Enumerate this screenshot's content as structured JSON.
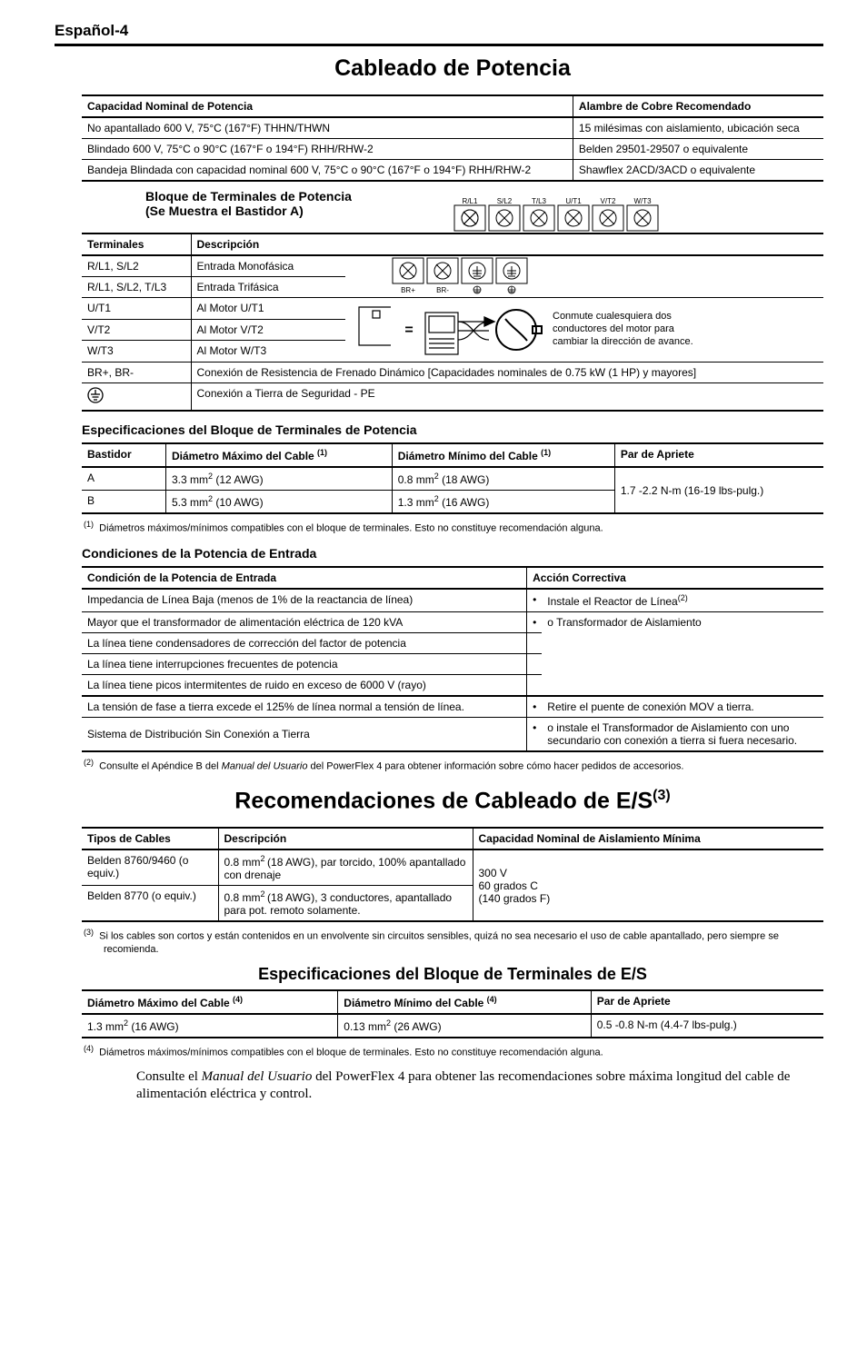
{
  "page_header": "Español-4",
  "section1": {
    "title": "Cableado de Potencia",
    "table1": {
      "h1": "Capacidad Nominal de Potencia",
      "h2": "Alambre de Cobre Recomendado",
      "r1c1": "No apantallado 600 V, 75°C (167°F) THHN/THWN",
      "r1c2": "15 milésimas con aislamiento, ubicación seca",
      "r2c1": "Blindado 600 V, 75°C o 90°C (167°F o 194°F) RHH/RHW-2",
      "r2c2": "Belden 29501-29507 o equivalente",
      "r3c1": "Bandeja Blindada con capacidad nominal 600 V, 75°C o 90°C (167°F o 194°F) RHH/RHW-2",
      "r3c2": "Shawflex 2ACD/3ACD o equivalente"
    },
    "terminal_block": {
      "title_l1": "Bloque de Terminales de Potencia",
      "title_l2": "(Se Muestra el Bastidor A)",
      "h1": "Terminales",
      "h2": "Descripción",
      "r1c1": "R/L1, S/L2",
      "r1c2": "Entrada Monofásica",
      "r2c1": "R/L1, S/L2, T/L3",
      "r2c2": "Entrada Trifásica",
      "r3c1": "U/T1",
      "r3c2": "Al Motor U/T1",
      "r4c1": "V/T2",
      "r4c2": "Al Motor V/T2",
      "r5c1": "W/T3",
      "r5c2": "Al Motor W/T3",
      "r6c1": "BR+, BR-",
      "r6c2": "Conexión de Resistencia de Frenado Dinámico [Capacidades nominales de 0.75 kW (1 HP) y mayores]",
      "r7c1": "",
      "r7c2": "Conexión a Tierra de Seguridad - PE",
      "labels": {
        "t1": "R/L1",
        "t2": "S/L2",
        "t3": "T/L3",
        "t4": "U/T1",
        "t5": "V/T2",
        "t6": "W/T3",
        "b1": "BR+",
        "b2": "BR-"
      },
      "motor_note_l1": "Conmute cualesquiera dos",
      "motor_note_l2": "conductores del motor para",
      "motor_note_l3": "cambiar la dirección de avance.",
      "eq": "="
    },
    "spec_title": "Especificaciones del Bloque de Terminales de Potencia",
    "spec_table": {
      "h1": "Bastidor",
      "h2a": "Diámetro Máximo del Cable ",
      "h2s": "(1)",
      "h3a": "Diámetro Mínimo del Cable ",
      "h3s": "(1)",
      "h4": "Par de Apriete",
      "r1c1": "A",
      "r1c2a": "3.3 mm",
      "r1c2s": "2",
      "r1c2b": " (12 AWG)",
      "r1c3a": "0.8 mm",
      "r1c3s": "2",
      "r1c3b": " (18 AWG)",
      "r2c1": "B",
      "r2c2a": "5.3 mm",
      "r2c2s": "2",
      "r2c2b": " (10 AWG)",
      "r2c3a": "1.3 mm",
      "r2c3s": "2",
      "r2c3b": " (16 AWG)",
      "rmc4": "1.7 -2.2 N-m (16-19 lbs-pulg.)"
    },
    "foot1_sup": "(1)",
    "foot1": "Diámetros máximos/mínimos compatibles con el bloque de terminales. Esto no constituye recomendación alguna.",
    "cond_title": "Condiciones de la Potencia de Entrada",
    "cond_table": {
      "h1": "Condición de la Potencia de Entrada",
      "h2": "Acción Correctiva",
      "r1": "Impedancia de Línea Baja (menos de 1% de la reactancia de línea)",
      "a1a": "Instale el Reactor de Línea",
      "a1s": "(2)",
      "a1b": "o Transformador de Aislamiento",
      "r2": "Mayor que el transformador de alimentación eléctrica de 120 kVA",
      "r3": "La línea tiene condensadores de corrección del factor de potencia",
      "r4": "La línea tiene interrupciones frecuentes de potencia",
      "r5": "La línea tiene picos intermitentes de ruido en exceso de 6000 V (rayo)",
      "r6": "La tensión de fase a tierra excede el 125% de línea normal a tensión de línea.",
      "r7": "Sistema de Distribución Sin Conexión a Tierra",
      "a2a": "Retire el puente de conexión MOV a tierra.",
      "a2b": "o instale el Transformador de Aislamiento con uno secundario con conexión a tierra si fuera necesario."
    },
    "foot2_sup": "(2)",
    "foot2a": "Consulte el Apéndice B del ",
    "foot2i": "Manual del Usuario",
    "foot2b": " del PowerFlex 4 para obtener información sobre cómo hacer pedidos de accesorios."
  },
  "section2": {
    "title_a": "Recomendaciones de Cableado de E/S",
    "title_s": "(3)",
    "table": {
      "h1": "Tipos de Cables",
      "h2": "Descripción",
      "h3": "Capacidad Nominal de Aislamiento Mínima",
      "r1c1": "Belden 8760/9460 (o equiv.)",
      "r1c2a": "0.8 mm",
      "r1c2s": "2 ",
      "r1c2b": "(18 AWG), par torcido, 100% apantallado con drenaje",
      "r2c1": "Belden 8770 (o equiv.)",
      "r2c2a": "0.8 mm",
      "r2c2s": "2 ",
      "r2c2b": "(18 AWG), 3 conductores, apantallado para pot. remoto solamente.",
      "rmc3_l1": "300 V",
      "rmc3_l2": "60 grados C",
      "rmc3_l3": "(140 grados F)"
    },
    "foot3_sup": "(3)",
    "foot3": "Si los cables son cortos y están contenidos en un envolvente sin circuitos sensibles, quizá no sea necesario el uso de cable apantallado, pero siempre se recomienda.",
    "spec_title": "Especificaciones del Bloque de Terminales de E/S",
    "spec_table": {
      "h1a": "Diámetro Máximo del Cable ",
      "h1s": "(4)",
      "h2a": "Diámetro Mínimo del Cable ",
      "h2s": "(4)",
      "h3": "Par de Apriete",
      "r1c1a": "1.3 mm",
      "r1c1s": "2",
      "r1c1b": " (16 AWG)",
      "r1c2a": "0.13 mm",
      "r1c2s": "2",
      "r1c2b": " (26 AWG)",
      "r1c3": "0.5 -0.8 N-m (4.4-7 lbs-pulg.)"
    },
    "foot4_sup": "(4)",
    "foot4": "Diámetros máximos/mínimos compatibles con el bloque de terminales. Esto no constituye recomendación alguna.",
    "closing_a": "Consulte el ",
    "closing_i": "Manual del Usuario",
    "closing_b": " del PowerFlex 4 para obtener las recomendaciones sobre máxima longitud del cable de alimentación eléctrica y control."
  },
  "chart_data": {
    "type": "table",
    "tables": [
      {
        "title": "Capacidad Nominal de Potencia / Alambre de Cobre Recomendado",
        "columns": [
          "Capacidad Nominal de Potencia",
          "Alambre de Cobre Recomendado"
        ],
        "rows": [
          [
            "No apantallado 600 V, 75°C (167°F) THHN/THWN",
            "15 milésimas con aislamiento, ubicación seca"
          ],
          [
            "Blindado 600 V, 75°C o 90°C (167°F o 194°F) RHH/RHW-2",
            "Belden 29501-29507 o equivalente"
          ],
          [
            "Bandeja Blindada con capacidad nominal 600 V, 75°C o 90°C (167°F o 194°F) RHH/RHW-2",
            "Shawflex 2ACD/3ACD o equivalente"
          ]
        ]
      },
      {
        "title": "Bloque de Terminales de Potencia",
        "columns": [
          "Terminales",
          "Descripción"
        ],
        "rows": [
          [
            "R/L1, S/L2",
            "Entrada Monofásica"
          ],
          [
            "R/L1, S/L2, T/L3",
            "Entrada Trifásica"
          ],
          [
            "U/T1",
            "Al Motor U/T1"
          ],
          [
            "V/T2",
            "Al Motor V/T2"
          ],
          [
            "W/T3",
            "Al Motor W/T3"
          ],
          [
            "BR+, BR-",
            "Conexión de Resistencia de Frenado Dinámico [Capacidades nominales de 0.75 kW (1 HP) y mayores]"
          ],
          [
            "⏚ (PE)",
            "Conexión a Tierra de Seguridad - PE"
          ]
        ]
      },
      {
        "title": "Especificaciones del Bloque de Terminales de Potencia",
        "columns": [
          "Bastidor",
          "Diámetro Máximo del Cable",
          "Diámetro Mínimo del Cable",
          "Par de Apriete"
        ],
        "rows": [
          [
            "A",
            "3.3 mm² (12 AWG)",
            "0.8 mm² (18 AWG)",
            "1.7 -2.2 N-m (16-19 lbs-pulg.)"
          ],
          [
            "B",
            "5.3 mm² (10 AWG)",
            "1.3 mm² (16 AWG)",
            "1.7 -2.2 N-m (16-19 lbs-pulg.)"
          ]
        ]
      },
      {
        "title": "Condiciones de la Potencia de Entrada",
        "columns": [
          "Condición de la Potencia de Entrada",
          "Acción Correctiva"
        ],
        "rows": [
          [
            "Impedancia de Línea Baja (menos de 1% de la reactancia de línea)",
            "Instale el Reactor de Línea / o Transformador de Aislamiento"
          ],
          [
            "Mayor que el transformador de alimentación eléctrica de 120 kVA",
            "Instale el Reactor de Línea / o Transformador de Aislamiento"
          ],
          [
            "La línea tiene condensadores de corrección del factor de potencia",
            "Instale el Reactor de Línea / o Transformador de Aislamiento"
          ],
          [
            "La línea tiene interrupciones frecuentes de potencia",
            "Instale el Reactor de Línea / o Transformador de Aislamiento"
          ],
          [
            "La línea tiene picos intermitentes de ruido en exceso de 6000 V (rayo)",
            "Instale el Reactor de Línea / o Transformador de Aislamiento"
          ],
          [
            "La tensión de fase a tierra excede el 125% de línea normal a tensión de línea.",
            "Retire el puente de conexión MOV a tierra / o instale Transformador de Aislamiento con uno secundario con conexión a tierra si fuera necesario."
          ],
          [
            "Sistema de Distribución Sin Conexión a Tierra",
            "Retire el puente de conexión MOV a tierra / o instale Transformador de Aislamiento con uno secundario con conexión a tierra si fuera necesario."
          ]
        ]
      },
      {
        "title": "Recomendaciones de Cableado de E/S",
        "columns": [
          "Tipos de Cables",
          "Descripción",
          "Capacidad Nominal de Aislamiento Mínima"
        ],
        "rows": [
          [
            "Belden 8760/9460 (o equiv.)",
            "0.8 mm² (18 AWG), par torcido, 100% apantallado con drenaje",
            "300 V, 60 grados C (140 grados F)"
          ],
          [
            "Belden 8770 (o equiv.)",
            "0.8 mm² (18 AWG), 3 conductores, apantallado para pot. remoto solamente.",
            "300 V, 60 grados C (140 grados F)"
          ]
        ]
      },
      {
        "title": "Especificaciones del Bloque de Terminales de E/S",
        "columns": [
          "Diámetro Máximo del Cable",
          "Diámetro Mínimo del Cable",
          "Par de Apriete"
        ],
        "rows": [
          [
            "1.3 mm² (16 AWG)",
            "0.13 mm² (26 AWG)",
            "0.5 -0.8 N-m (4.4-7 lbs-pulg.)"
          ]
        ]
      }
    ]
  }
}
